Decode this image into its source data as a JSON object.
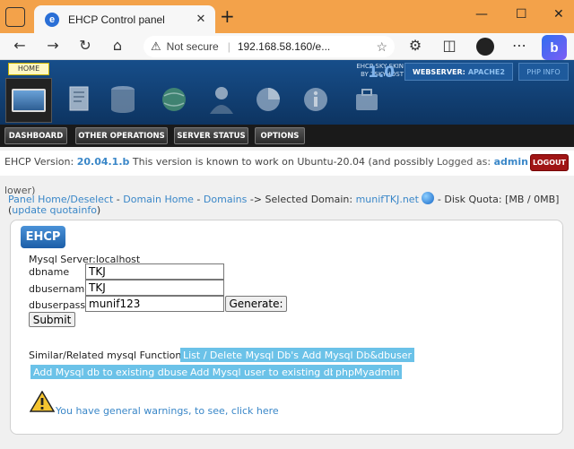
{
  "browser": {
    "tab_title": "EHCP Control panel",
    "tab_favicon_letter": "e",
    "new_tab_glyph": "+",
    "close_glyph": "✕",
    "minimize_glyph": "—",
    "maximize_glyph": "☐",
    "window_close_glyph": "✕",
    "not_secure": "Not secure",
    "url": "192.168.58.160/e...",
    "bing_letter": "b"
  },
  "header": {
    "home_label": "HOME",
    "skin_line1": "EHCP SKY SKIN",
    "skin_line2": "BY 7SKYHOST",
    "skin_version": "1.0",
    "webserver_label": "WEBSERVER:",
    "webserver_value": "APACHE2",
    "phpinfo": "PHP INFO"
  },
  "nav": {
    "dashboard": "DASHBOARD",
    "other_operations": "OTHER OPERATIONS",
    "server_status": "SERVER STATUS",
    "options": "OPTIONS"
  },
  "info": {
    "version_label": "EHCP Version:",
    "version_number": "20.04.1.b",
    "version_note": "This version is known to work on Ubuntu-20.04 (and possibly",
    "version_note_tail": "lower)",
    "logged_as": "Logged as:",
    "user": "admin",
    "logout": "LOGOUT"
  },
  "breadcrumb": {
    "panel_home": "Panel Home/Deselect",
    "sep1": " - ",
    "domain_home": "Domain Home",
    "sep2": " - ",
    "domains": "Domains",
    "selected_prefix": " -> Selected Domain: ",
    "domain": "munifTKJ.net",
    "quota_text": " - Disk Quota: [MB / 0MB] (",
    "update_quota": "update quotainfo",
    "close_paren": ")"
  },
  "form": {
    "badge": "EHCP",
    "mysql_server": "Mysql Server:localhost",
    "dbname_label": "dbname",
    "dbname_value": "TKJ",
    "dbusername_label": "dbusername",
    "dbusername_value": "TKJ",
    "dbuserpass_label": "dbuserpass",
    "dbuserpass_value": "munif123",
    "generate": "Generate:",
    "submit": "Submit"
  },
  "related": {
    "label": "Similar/Related mysql Functions:",
    "links": [
      "List / Delete Mysql Db's",
      "Add Mysql Db&dbuser",
      "Add Mysql db to existing dbuser",
      "Add Mysql user to existing db",
      "phpMyadmin"
    ]
  },
  "warning": {
    "text": "You have general warnings, to see, click here"
  },
  "colors": {
    "tabstrip": "#f3a24a",
    "header_blue": "#174e8a",
    "link_blue": "#3a87c8",
    "related_link_bg": "#6bc2e8",
    "logout_red": "#a01515"
  }
}
